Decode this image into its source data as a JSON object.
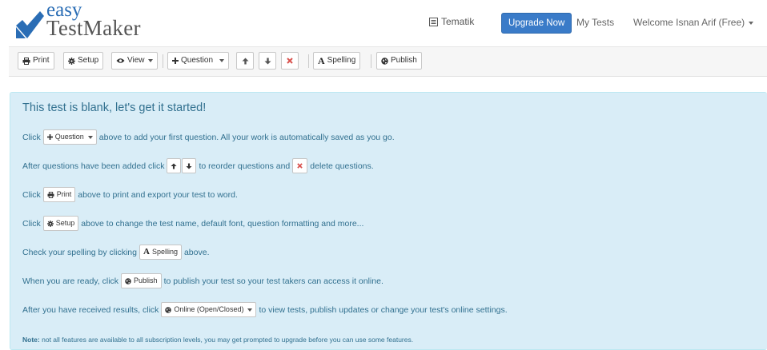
{
  "header": {
    "logo_small": "easy",
    "logo_large": "TestMaker",
    "tematik_label": "Tematik",
    "upgrade_label": "Upgrade Now",
    "my_tests_label": "My Tests",
    "welcome_label": "Welcome Isnan Arif (Free)"
  },
  "toolbar": {
    "print_label": "Print",
    "setup_label": "Setup",
    "view_label": "View",
    "question_label": "Question",
    "spelling_label": "Spelling",
    "publish_label": "Publish"
  },
  "panel": {
    "title": "This test is blank, let's get it started!",
    "line1": {
      "before": "Click",
      "button": "Question",
      "after": "above to add your first question. All your work is automatically saved as you go."
    },
    "line2": {
      "before": "After questions have been added click",
      "middle": "to reorder questions and",
      "after": "delete questions."
    },
    "line3": {
      "before": "Click",
      "button": "Print",
      "after": "above to print and export your test to word."
    },
    "line4": {
      "before": "Click",
      "button": "Setup",
      "after": "above to change the test name, default font, question formatting and more..."
    },
    "line5": {
      "before": "Check your spelling by clicking",
      "button": "Spelling",
      "after": "above."
    },
    "line6": {
      "before": "When you are ready, click",
      "button": "Publish",
      "after": "to publish your test so your test takers can access it online."
    },
    "line7": {
      "before": "After you have received results, click",
      "button": "Online (Open/Closed)",
      "after": "to view tests, publish updates or change your test's online settings."
    },
    "note_label": "Note:",
    "note_text": "not all features are available to all subscription levels, you may get prompted to upgrade before you can use some features."
  },
  "icons": {
    "logo": "checkmark-logo-icon",
    "tematik": "list-icon",
    "print": "printer-icon",
    "setup": "gear-icon",
    "view": "eye-icon",
    "question": "plus-icon",
    "up": "arrow-up-icon",
    "down": "arrow-down-icon",
    "delete": "close-icon",
    "publish": "globe-icon"
  },
  "colors": {
    "brand_blue": "#2a6db5",
    "upgrade_button": "#3a7bc8",
    "panel_bg": "#d9edf7",
    "panel_text": "#31708f",
    "delete_red": "#d9534f"
  }
}
